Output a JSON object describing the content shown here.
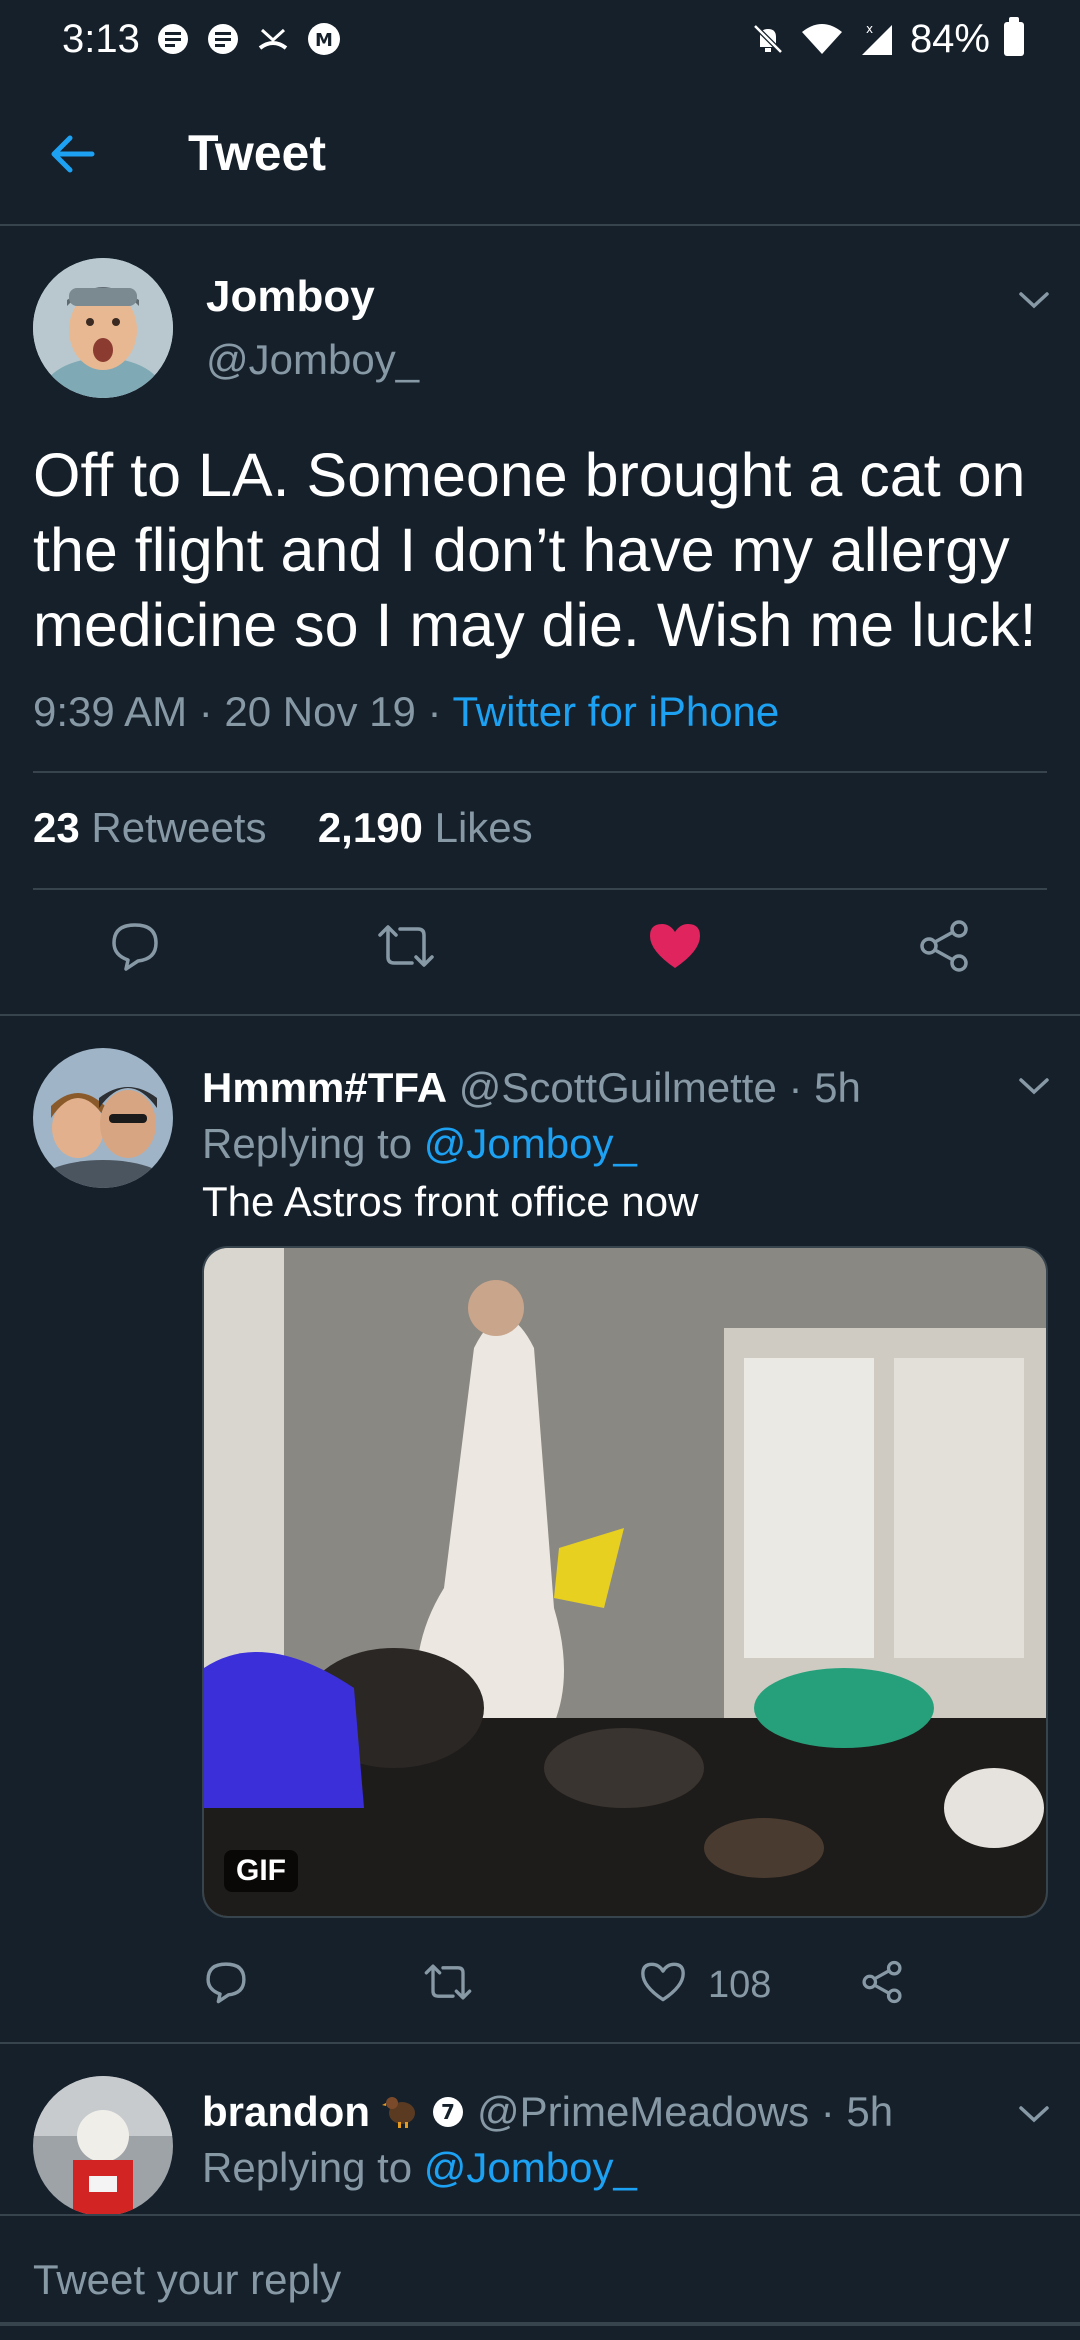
{
  "status_bar": {
    "time": "3:13",
    "battery": "84%",
    "notification_icons": [
      "message-badge-icon",
      "message-badge-icon",
      "missed-call-icon",
      "gmail-icon"
    ],
    "system_icons": [
      "mute-icon",
      "wifi-icon",
      "signal-icon",
      "battery-icon"
    ]
  },
  "app_bar": {
    "title": "Tweet"
  },
  "main_tweet": {
    "author_name": "Jomboy",
    "author_handle": "@Jomboy_",
    "text": "Off to LA. Someone brought a cat on the flight and I don’t have my allergy medicine so I may die. Wish me luck!",
    "meta": "9:39 AM · 20 Nov 19 · ",
    "source": "Twitter for iPhone",
    "retweets_count": "23",
    "retweets_label": "Retweets",
    "likes_count": "2,190",
    "likes_label": "Likes",
    "liked": true
  },
  "replies": [
    {
      "name": "Hmmm#TFA",
      "handle_time": "@ScottGuilmette · 5h",
      "replying_prefix": "Replying to ",
      "replying_to": "@Jomboy_",
      "text": "The Astros front office now",
      "media_badge": "GIF",
      "like_count": "108"
    },
    {
      "name": "brandon",
      "badge": "7",
      "handle_time": "@PrimeMeadows · 5h",
      "replying_prefix": "Replying to ",
      "replying_to": "@Jomboy_"
    }
  ],
  "compose": {
    "placeholder": "Tweet your reply"
  },
  "colors": {
    "background": "#15202b",
    "accent": "#1da1f2",
    "muted": "#8899a6",
    "like": "#e0245e",
    "divider": "#38444d"
  }
}
